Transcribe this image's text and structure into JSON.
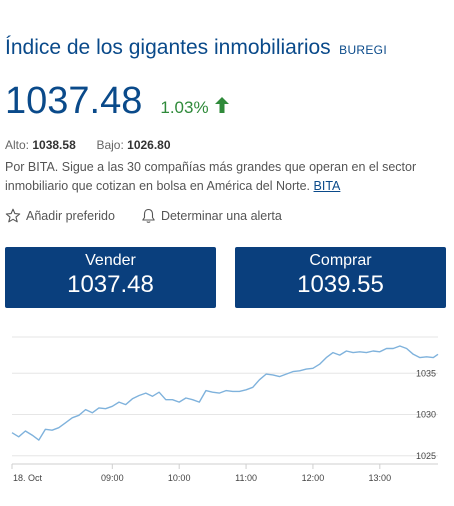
{
  "header": {
    "title": "Índice de los gigantes inmobiliarios",
    "ticker": "BUREGI"
  },
  "quote": {
    "price": "1037.48",
    "change_pct": "1.03%",
    "high_label": "Alto:",
    "high_value": "1038.58",
    "low_label": "Bajo:",
    "low_value": "1026.80"
  },
  "description": {
    "text": "Por BITA. Sigue a las 30 compañías más grandes que operan en el sector inmobiliario que cotizan en bolsa en América del Norte.",
    "link": "BITA"
  },
  "actions": {
    "favorite": "Añadir preferido",
    "alert": "Determinar una alerta"
  },
  "trade": {
    "sell_label": "Vender",
    "sell_value": "1037.48",
    "buy_label": "Comprar",
    "buy_value": "1039.55"
  },
  "colors": {
    "brand": "#0a4a8a",
    "button": "#0a3f7d",
    "positive": "#2f8a3a",
    "line": "#7fb2dc"
  },
  "chart_data": {
    "type": "line",
    "x_tick_labels": [
      "18. Oct",
      "09:00",
      "10:00",
      "11:00",
      "12:00",
      "13:00"
    ],
    "x_ticks": [
      0,
      1.5,
      2.5,
      3.5,
      4.5,
      5.5
    ],
    "y_ticks": [
      1025,
      1030,
      1035
    ],
    "ylim": [
      1024,
      1040
    ],
    "xlim": [
      0,
      6.37
    ],
    "grid": true,
    "series": [
      {
        "values": [
          [
            0.0,
            1027.8
          ],
          [
            0.1,
            1027.3
          ],
          [
            0.2,
            1028.0
          ],
          [
            0.3,
            1027.5
          ],
          [
            0.4,
            1026.9
          ],
          [
            0.5,
            1028.2
          ],
          [
            0.6,
            1028.1
          ],
          [
            0.7,
            1028.4
          ],
          [
            0.8,
            1029.0
          ],
          [
            0.9,
            1029.6
          ],
          [
            1.0,
            1029.9
          ],
          [
            1.1,
            1030.6
          ],
          [
            1.2,
            1030.2
          ],
          [
            1.3,
            1030.8
          ],
          [
            1.4,
            1030.7
          ],
          [
            1.5,
            1031.0
          ],
          [
            1.6,
            1031.5
          ],
          [
            1.7,
            1031.2
          ],
          [
            1.8,
            1031.9
          ],
          [
            1.9,
            1032.3
          ],
          [
            2.0,
            1032.6
          ],
          [
            2.1,
            1032.2
          ],
          [
            2.2,
            1032.7
          ],
          [
            2.3,
            1031.8
          ],
          [
            2.4,
            1031.8
          ],
          [
            2.5,
            1031.5
          ],
          [
            2.6,
            1032.0
          ],
          [
            2.7,
            1031.8
          ],
          [
            2.8,
            1031.5
          ],
          [
            2.9,
            1032.9
          ],
          [
            3.0,
            1032.7
          ],
          [
            3.1,
            1032.6
          ],
          [
            3.2,
            1032.9
          ],
          [
            3.3,
            1032.8
          ],
          [
            3.4,
            1032.8
          ],
          [
            3.5,
            1033.0
          ],
          [
            3.6,
            1033.3
          ],
          [
            3.7,
            1034.2
          ],
          [
            3.8,
            1034.9
          ],
          [
            3.9,
            1034.8
          ],
          [
            4.0,
            1034.6
          ],
          [
            4.1,
            1034.9
          ],
          [
            4.2,
            1035.2
          ],
          [
            4.3,
            1035.3
          ],
          [
            4.4,
            1035.5
          ],
          [
            4.5,
            1035.6
          ],
          [
            4.6,
            1036.1
          ],
          [
            4.7,
            1036.9
          ],
          [
            4.8,
            1037.5
          ],
          [
            4.9,
            1037.2
          ],
          [
            5.0,
            1037.7
          ],
          [
            5.1,
            1037.5
          ],
          [
            5.2,
            1037.6
          ],
          [
            5.3,
            1037.5
          ],
          [
            5.4,
            1037.7
          ],
          [
            5.5,
            1037.6
          ],
          [
            5.6,
            1038.0
          ],
          [
            5.7,
            1038.0
          ],
          [
            5.8,
            1038.3
          ],
          [
            5.9,
            1038.0
          ],
          [
            6.0,
            1037.3
          ],
          [
            6.1,
            1036.9
          ],
          [
            6.2,
            1037.0
          ],
          [
            6.3,
            1036.9
          ],
          [
            6.37,
            1037.3
          ]
        ]
      }
    ]
  }
}
